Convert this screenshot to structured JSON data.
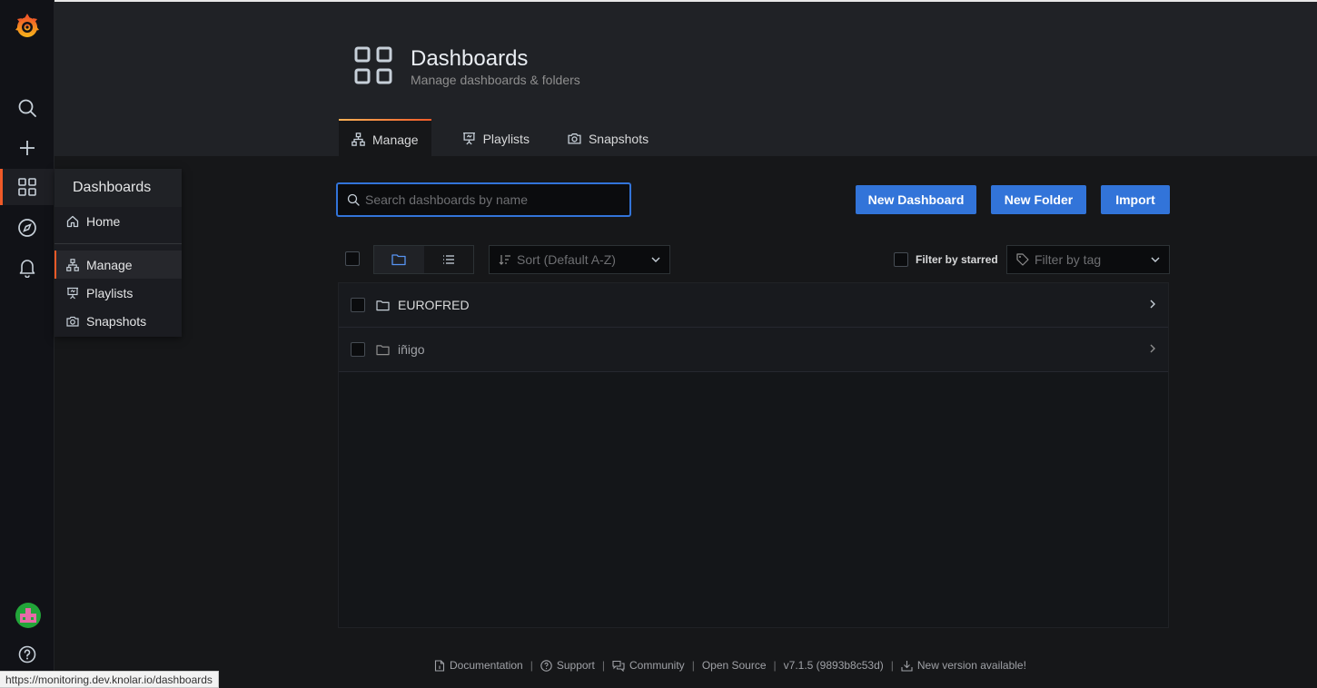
{
  "header": {
    "title": "Dashboards",
    "subtitle": "Manage dashboards & folders",
    "tabs": [
      {
        "label": "Manage",
        "icon": "sitemap-icon",
        "active": true
      },
      {
        "label": "Playlists",
        "icon": "presentation-icon"
      },
      {
        "label": "Snapshots",
        "icon": "camera-icon"
      }
    ]
  },
  "flyout": {
    "title": "Dashboards",
    "items": [
      {
        "label": "Home",
        "icon": "home-icon"
      },
      {
        "label": "Manage",
        "icon": "sitemap-icon",
        "active": true
      },
      {
        "label": "Playlists",
        "icon": "presentation-icon"
      },
      {
        "label": "Snapshots",
        "icon": "camera-icon"
      }
    ]
  },
  "toolbar": {
    "search_placeholder": "Search dashboards by name",
    "new_dashboard_label": "New Dashboard",
    "new_folder_label": "New Folder",
    "import_label": "Import"
  },
  "list": {
    "sort_label": "Sort (Default A-Z)",
    "filter_starred_label": "Filter by starred",
    "filter_tag_placeholder": "Filter by tag",
    "folders": [
      {
        "name": "EUROFRED"
      },
      {
        "name": "iñigo"
      }
    ]
  },
  "footer": {
    "documentation": "Documentation",
    "support": "Support",
    "community": "Community",
    "open_source": "Open Source",
    "version": "v7.1.5 (9893b8c53d)",
    "new_version": "New version available!"
  },
  "statusbar": {
    "url": "https://monitoring.dev.knolar.io/dashboards"
  },
  "colors": {
    "accent": "#3274d9",
    "brand": "#f05a28",
    "background": "#161719"
  }
}
